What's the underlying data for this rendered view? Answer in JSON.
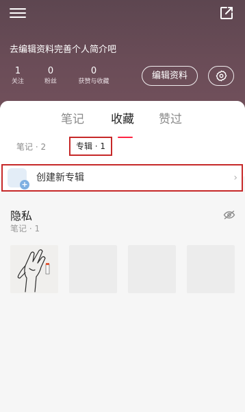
{
  "header": {
    "bio_prompt": "去编辑资料完善个人简介吧",
    "stats": [
      {
        "value": "1",
        "label": "关注"
      },
      {
        "value": "0",
        "label": "粉丝"
      },
      {
        "value": "0",
        "label": "获赞与收藏"
      }
    ],
    "edit_profile_label": "编辑资料"
  },
  "tabs": [
    {
      "label": "笔记"
    },
    {
      "label": "收藏",
      "active": true
    },
    {
      "label": "赞过"
    }
  ],
  "subtabs": [
    {
      "label": "笔记 · 2"
    },
    {
      "label": "专辑 · 1",
      "active": true
    }
  ],
  "create_album": {
    "label": "创建新专辑",
    "chevron": "›"
  },
  "album": {
    "title": "隐私",
    "subtitle": "笔记 · 1"
  },
  "colors": {
    "accent": "#ff2442",
    "highlight_box": "#c62828",
    "header_bg": "#6a4c57"
  }
}
